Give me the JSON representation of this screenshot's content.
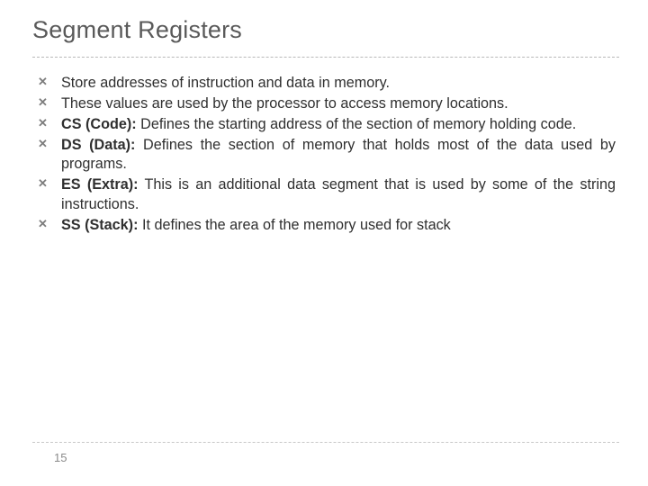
{
  "title": "Segment Registers",
  "bullets": [
    {
      "label": "",
      "text": "Store addresses of instruction and data in memory."
    },
    {
      "label": "",
      "text": "These values are used by the processor to access memory locations."
    },
    {
      "label": "CS (Code):",
      "text": " Defines the starting address of the section of memory holding code."
    },
    {
      "label": "DS (Data):",
      "text": " Defines the section of memory that holds most of the data used by programs."
    },
    {
      "label": "ES (Extra):",
      "text": " This is an additional data segment that is used by some of the string instructions."
    },
    {
      "label": "SS (Stack):",
      "text": " It defines the area of the memory used for stack"
    }
  ],
  "page_number": "15"
}
